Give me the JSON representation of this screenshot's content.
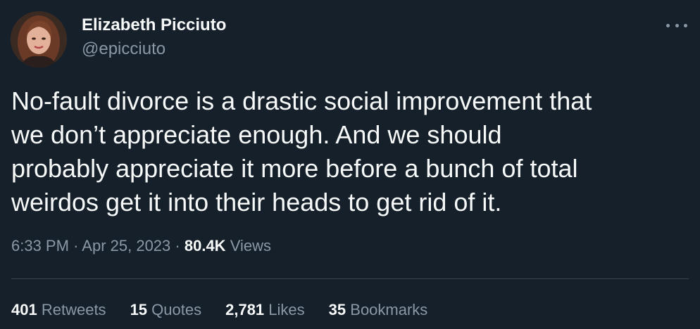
{
  "author": {
    "display_name": "Elizabeth Picciuto",
    "handle": "@epicciuto",
    "avatar": "profile-photo"
  },
  "tweet": {
    "lines": [
      "No-fault divorce is a drastic social improvement that",
      "we don’t appreciate enough. And we should",
      "probably appreciate it more before a bunch of total",
      "weirdos get it into their heads to get rid of it."
    ]
  },
  "meta": {
    "time": "6:33 PM",
    "separator": "·",
    "date": "Apr 25, 2023",
    "views_count": "80.4K",
    "views_label": "Views"
  },
  "stats": [
    {
      "count": "401",
      "label": "Retweets"
    },
    {
      "count": "15",
      "label": "Quotes"
    },
    {
      "count": "2,781",
      "label": "Likes"
    },
    {
      "count": "35",
      "label": "Bookmarks"
    }
  ],
  "icons": {
    "more": "more-horizontal-icon"
  },
  "colors": {
    "background": "#15202b",
    "primary_text": "#f7f9f9",
    "secondary_text": "#8b98a5",
    "divider": "#38444d"
  }
}
